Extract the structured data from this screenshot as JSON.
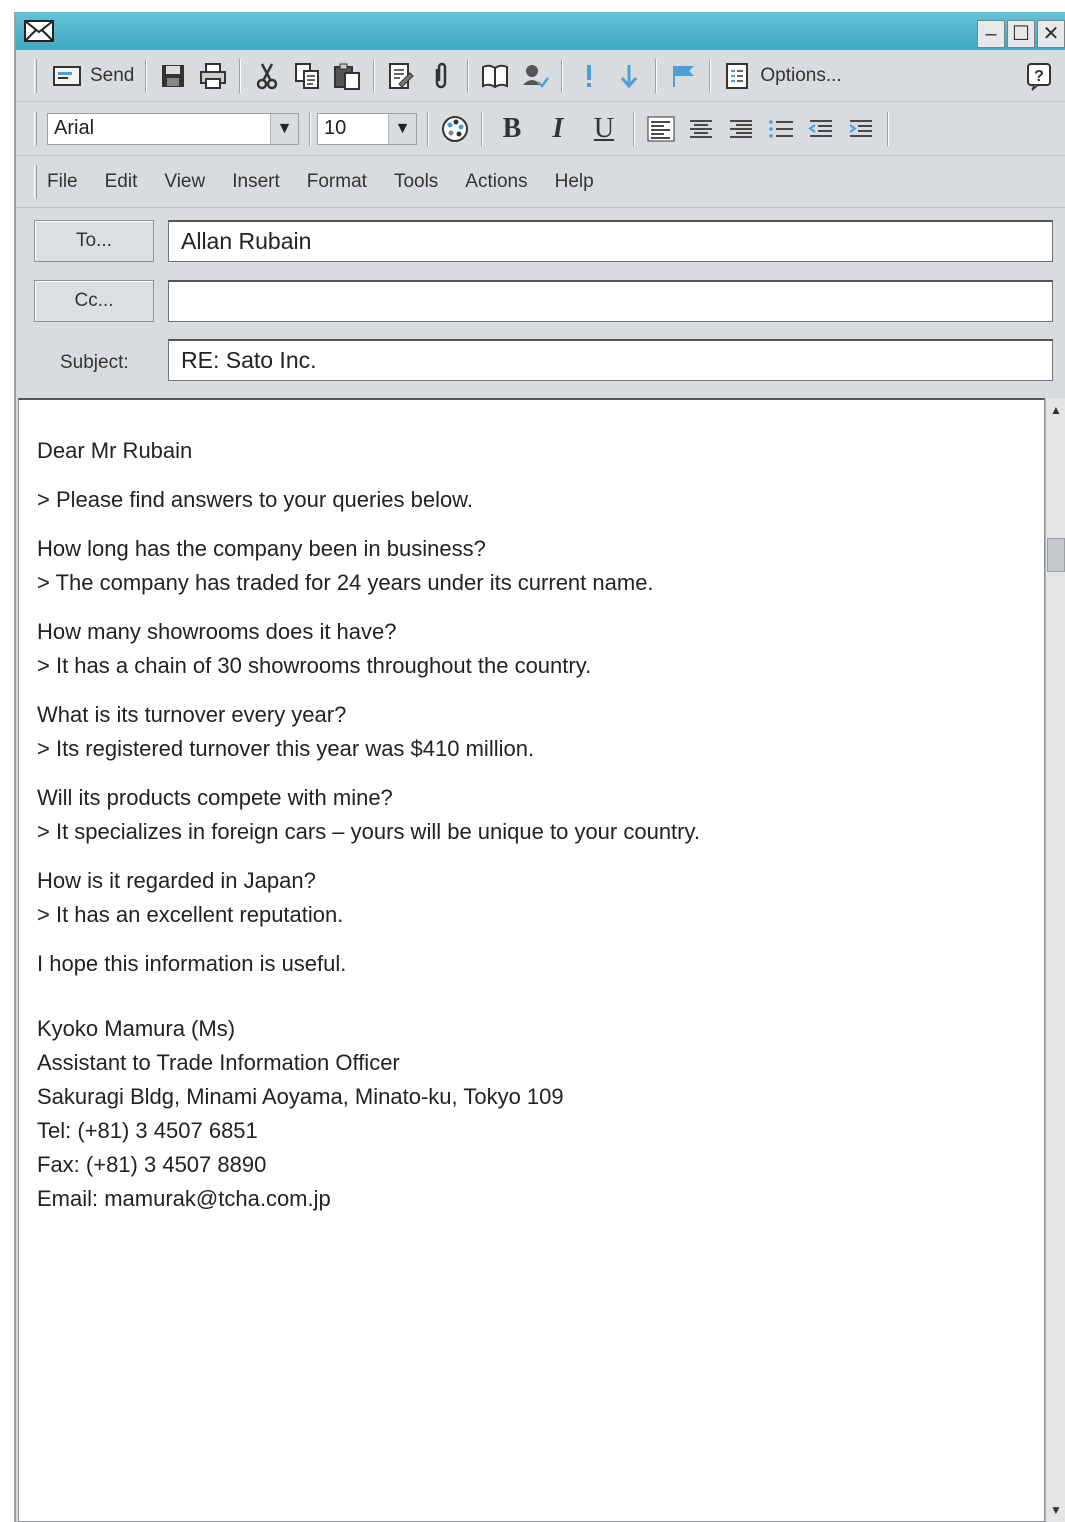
{
  "toolbar": {
    "send_label": "Send",
    "options_label": "Options...",
    "font_name": "Arial",
    "font_size": "10",
    "bold_label": "B",
    "italic_label": "I",
    "underline_label": "U"
  },
  "menu": [
    "File",
    "Edit",
    "View",
    "Insert",
    "Format",
    "Tools",
    "Actions",
    "Help"
  ],
  "fields": {
    "to_button": "To...",
    "to_value": "Allan Rubain",
    "cc_button": "Cc...",
    "cc_value": "",
    "subject_label": "Subject:",
    "subject_value": "RE: Sato Inc."
  },
  "message": {
    "greeting": "Dear Mr Rubain",
    "intro": "> Please find answers to your queries below.",
    "qa": [
      {
        "q": "How long has the company been in business?",
        "a": "> The company has traded for 24 years under its current name."
      },
      {
        "q": "How many showrooms does it have?",
        "a": "> It has a chain of 30 showrooms throughout the country."
      },
      {
        "q": "What is its turnover every year?",
        "a": "> Its registered turnover this year was $410 million."
      },
      {
        "q": "Will its products compete with mine?",
        "a": "> It specializes in foreign cars – yours will be unique to your country."
      },
      {
        "q": "How is it regarded in Japan?",
        "a": "> It has an excellent reputation."
      }
    ],
    "closing": "I hope this information is useful.",
    "signature": [
      "Kyoko Mamura (Ms)",
      "Assistant to Trade Information Officer",
      "Sakuragi Bldg, Minami Aoyama, Minato-ku, Tokyo 109",
      "Tel: (+81) 3 4507 6851",
      "Fax: (+81) 3 4507 8890",
      "Email: mamurak@tcha.com.jp"
    ]
  },
  "colors": {
    "titlebar": "#4fb6cc",
    "chrome": "#d9dcdf",
    "accent_arrows": "#4a9fd8"
  }
}
